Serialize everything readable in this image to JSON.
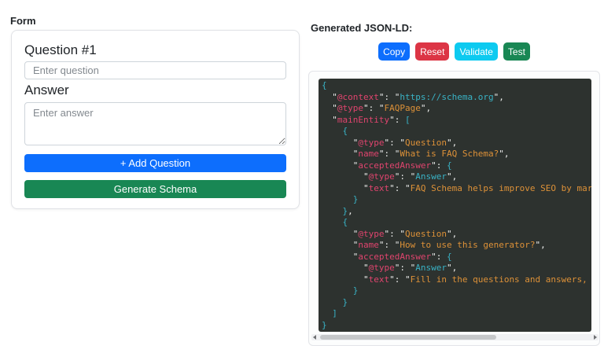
{
  "form_panel": {
    "title": "Form",
    "question_heading": "Question #1",
    "question_placeholder": "Enter question",
    "answer_heading": "Answer",
    "answer_placeholder": "Enter answer",
    "add_question_label": "+ Add Question",
    "add_question_color": "#0d6efd",
    "generate_label": "Generate Schema",
    "generate_color": "#198754"
  },
  "output_panel": {
    "title": "Generated JSON-LD:",
    "action_buttons": [
      {
        "label": "Copy",
        "name": "copy-button",
        "color": "#0d6efd"
      },
      {
        "label": "Reset",
        "name": "reset-button",
        "color": "#dc3545"
      },
      {
        "label": "Validate",
        "name": "validate-button",
        "color": "#0dcaf0"
      },
      {
        "label": "Test",
        "name": "test-button",
        "color": "#198754"
      }
    ],
    "code": {
      "colors": {
        "background": "#2d322f",
        "key": "#e0446e",
        "string_cyan": "#39b3c6",
        "string_orange": "#dd9138",
        "punctuation": "#ecedec",
        "bracket": "#39b3c6"
      },
      "lines": [
        [
          [
            "b",
            "{"
          ]
        ],
        [
          [
            "p",
            "  \""
          ],
          [
            "k",
            "@context"
          ],
          [
            "p",
            "\": \""
          ],
          [
            "c",
            "https://schema.org"
          ],
          [
            "p",
            "\","
          ]
        ],
        [
          [
            "p",
            "  \""
          ],
          [
            "k",
            "@type"
          ],
          [
            "p",
            "\": \""
          ],
          [
            "o",
            "FAQPage"
          ],
          [
            "p",
            "\","
          ]
        ],
        [
          [
            "p",
            "  \""
          ],
          [
            "k",
            "mainEntity"
          ],
          [
            "p",
            "\": "
          ],
          [
            "b",
            "["
          ]
        ],
        [
          [
            "p",
            "    "
          ],
          [
            "b",
            "{"
          ]
        ],
        [
          [
            "p",
            "      \""
          ],
          [
            "k",
            "@type"
          ],
          [
            "p",
            "\": \""
          ],
          [
            "o",
            "Question"
          ],
          [
            "p",
            "\","
          ]
        ],
        [
          [
            "p",
            "      \""
          ],
          [
            "k",
            "name"
          ],
          [
            "p",
            "\": \""
          ],
          [
            "o",
            "What is FAQ Schema?"
          ],
          [
            "p",
            "\","
          ]
        ],
        [
          [
            "p",
            "      \""
          ],
          [
            "k",
            "acceptedAnswer"
          ],
          [
            "p",
            "\": "
          ],
          [
            "b",
            "{"
          ]
        ],
        [
          [
            "p",
            "        \""
          ],
          [
            "k",
            "@type"
          ],
          [
            "p",
            "\": \""
          ],
          [
            "c",
            "Answer"
          ],
          [
            "p",
            "\","
          ]
        ],
        [
          [
            "p",
            "        \""
          ],
          [
            "k",
            "text"
          ],
          [
            "p",
            "\": \""
          ],
          [
            "o",
            "FAQ Schema helps improve SEO by marking"
          ]
        ],
        [
          [
            "p",
            "      "
          ],
          [
            "b",
            "}"
          ]
        ],
        [
          [
            "p",
            "    "
          ],
          [
            "b",
            "}"
          ],
          [
            "p",
            ","
          ]
        ],
        [
          [
            "p",
            "    "
          ],
          [
            "b",
            "{"
          ]
        ],
        [
          [
            "p",
            "      \""
          ],
          [
            "k",
            "@type"
          ],
          [
            "p",
            "\": \""
          ],
          [
            "o",
            "Question"
          ],
          [
            "p",
            "\","
          ]
        ],
        [
          [
            "p",
            "      \""
          ],
          [
            "k",
            "name"
          ],
          [
            "p",
            "\": \""
          ],
          [
            "o",
            "How to use this generator?"
          ],
          [
            "p",
            "\","
          ]
        ],
        [
          [
            "p",
            "      \""
          ],
          [
            "k",
            "acceptedAnswer"
          ],
          [
            "p",
            "\": "
          ],
          [
            "b",
            "{"
          ]
        ],
        [
          [
            "p",
            "        \""
          ],
          [
            "k",
            "@type"
          ],
          [
            "p",
            "\": \""
          ],
          [
            "c",
            "Answer"
          ],
          [
            "p",
            "\","
          ]
        ],
        [
          [
            "p",
            "        \""
          ],
          [
            "k",
            "text"
          ],
          [
            "p",
            "\": \""
          ],
          [
            "o",
            "Fill in the questions and answers, the"
          ]
        ],
        [
          [
            "p",
            "      "
          ],
          [
            "b",
            "}"
          ]
        ],
        [
          [
            "p",
            "    "
          ],
          [
            "b",
            "}"
          ]
        ],
        [
          [
            "p",
            "  "
          ],
          [
            "b",
            "]"
          ]
        ],
        [
          [
            "b",
            "}"
          ]
        ]
      ]
    }
  }
}
